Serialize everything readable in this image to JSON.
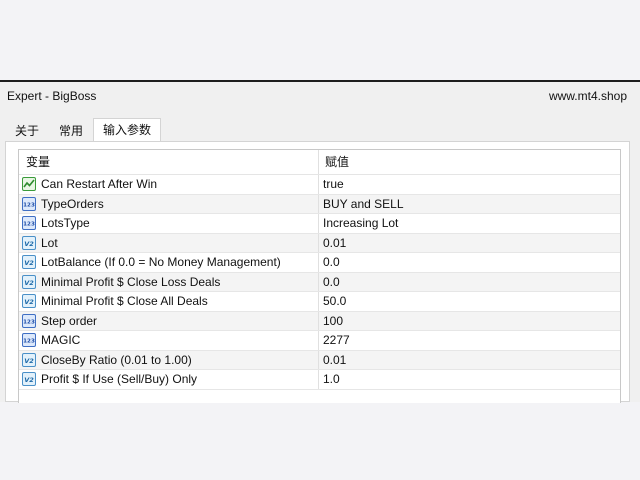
{
  "window": {
    "title": "Expert - BigBoss",
    "watermark": "www.mt4.shop"
  },
  "tabs": [
    {
      "label": "关于",
      "active": false
    },
    {
      "label": "常用",
      "active": false
    },
    {
      "label": "输入参数",
      "active": true
    }
  ],
  "table": {
    "columns": [
      "变量",
      "赋值"
    ],
    "rows": [
      {
        "type_icon": "bool-icon",
        "name": "Can Restart After Win",
        "value": "true"
      },
      {
        "type_icon": "int-icon",
        "name": "TypeOrders",
        "value": "BUY and SELL"
      },
      {
        "type_icon": "int-icon",
        "name": "LotsType",
        "value": "Increasing Lot"
      },
      {
        "type_icon": "double-icon",
        "name": "Lot",
        "value": "0.01"
      },
      {
        "type_icon": "double-icon",
        "name": "LotBalance (If 0.0 = No Money Management)",
        "value": "0.0"
      },
      {
        "type_icon": "double-icon",
        "name": "Minimal Profit $ Close Loss Deals",
        "value": "0.0"
      },
      {
        "type_icon": "double-icon",
        "name": "Minimal Profit $ Close All Deals",
        "value": "50.0"
      },
      {
        "type_icon": "int-icon",
        "name": "Step order",
        "value": "100"
      },
      {
        "type_icon": "int-icon",
        "name": "MAGIC",
        "value": "2277"
      },
      {
        "type_icon": "double-icon",
        "name": "CloseBy Ratio (0.01 to 1.00)",
        "value": "0.01"
      },
      {
        "type_icon": "double-icon",
        "name": "Profit $ If Use (Sell/Buy) Only",
        "value": "1.0"
      }
    ]
  }
}
